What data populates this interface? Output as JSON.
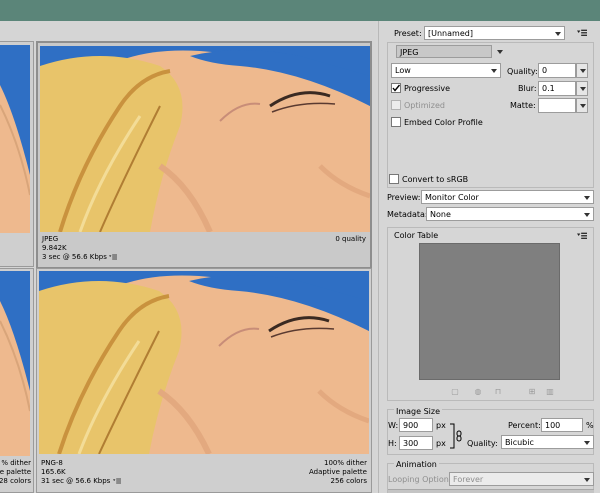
{
  "preview": {
    "top_left": {
      "lines": []
    },
    "top_right": {
      "format": "JPEG",
      "size": "9.842K",
      "time": "3 sec @ 56.6 Kbps",
      "right_text": "0 quality"
    },
    "bottom_left": {
      "right_lines": [
        "% dither",
        "e palette",
        "28 colors"
      ]
    },
    "bottom_right": {
      "format": "PNG-8",
      "size": "165.6K",
      "time": "31 sec @ 56.6 Kbps",
      "right_lines": [
        "100% dither",
        "Adaptive palette",
        "256 colors"
      ]
    }
  },
  "panel": {
    "preset_label": "Preset:",
    "preset_value": "[Unnamed]",
    "format_value": "JPEG",
    "quality_level": "Low",
    "quality_label": "Quality:",
    "quality_value": "0",
    "progressive_label": "Progressive",
    "progressive_checked": true,
    "blur_label": "Blur:",
    "blur_value": "0.1",
    "optimized_label": "Optimized",
    "matte_label": "Matte:",
    "embed_label": "Embed Color Profile",
    "convert_label": "Convert to sRGB",
    "preview_label": "Preview:",
    "preview_value": "Monitor Color",
    "metadata_label": "Metadata:",
    "metadata_value": "None",
    "color_table_title": "Color Table",
    "image_size_title": "Image Size",
    "w_label": "W:",
    "w_value": "900",
    "h_label": "H:",
    "h_value": "300",
    "px_unit": "px",
    "percent_label": "Percent:",
    "percent_value": "100",
    "percent_unit": "%",
    "quality2_label": "Quality:",
    "quality2_value": "Bicubic",
    "animation_title": "Animation",
    "looping_label": "Looping Options:",
    "looping_value": "Forever"
  },
  "colors": {
    "titlebar": "#5b8579",
    "swatch_gray": "#7f7f7f",
    "sky_blue": "#2f6fc4",
    "skin": "#eeb98e",
    "hair": "#e8c46a"
  },
  "icons": [
    "panel-menu-icon",
    "link-icon",
    "checkmark-icon",
    "dropdown-arrow-icon"
  ]
}
